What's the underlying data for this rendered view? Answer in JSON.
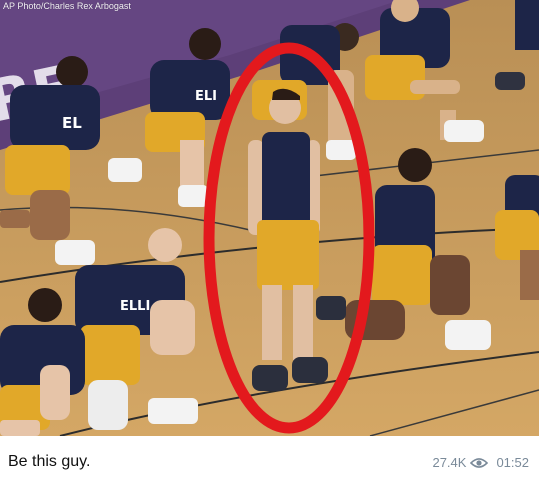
{
  "photo": {
    "credit": "AP Photo/Charles Rex Arbogast",
    "court_text": "RE",
    "jersey_texts": [
      "EL",
      "ELI",
      "ELLI"
    ],
    "highlight_color": "#e3191d"
  },
  "post": {
    "caption": "Be this guy.",
    "views": "27.4K",
    "time": "01:52",
    "views_icon": "eye-icon"
  }
}
